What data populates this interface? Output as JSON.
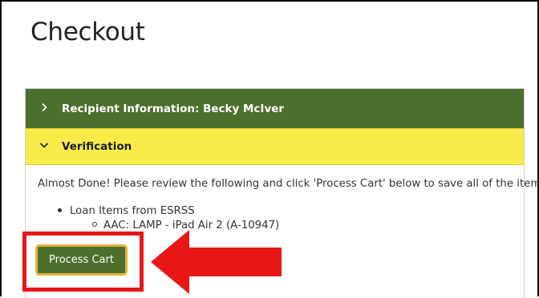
{
  "page": {
    "title": "Checkout"
  },
  "accordion": {
    "recipient": {
      "label": "Recipient Information: Becky McIver",
      "expanded": false,
      "icon": "chevron-right-icon",
      "color": "#4b6f2c"
    },
    "verification": {
      "label": "Verification",
      "expanded": true,
      "icon": "chevron-down-icon",
      "color": "#f9ec4a"
    }
  },
  "verification": {
    "instructions": "Almost Done! Please review the following and click 'Process Cart' below to save all of the items.",
    "items": [
      {
        "label": "Loan Items from ESRSS",
        "children": [
          "AAC: LAMP - iPad Air 2 (A-10947)"
        ]
      }
    ]
  },
  "actions": {
    "process_label": "Process Cart"
  },
  "annotation": {
    "highlight_color": "#e81717"
  }
}
